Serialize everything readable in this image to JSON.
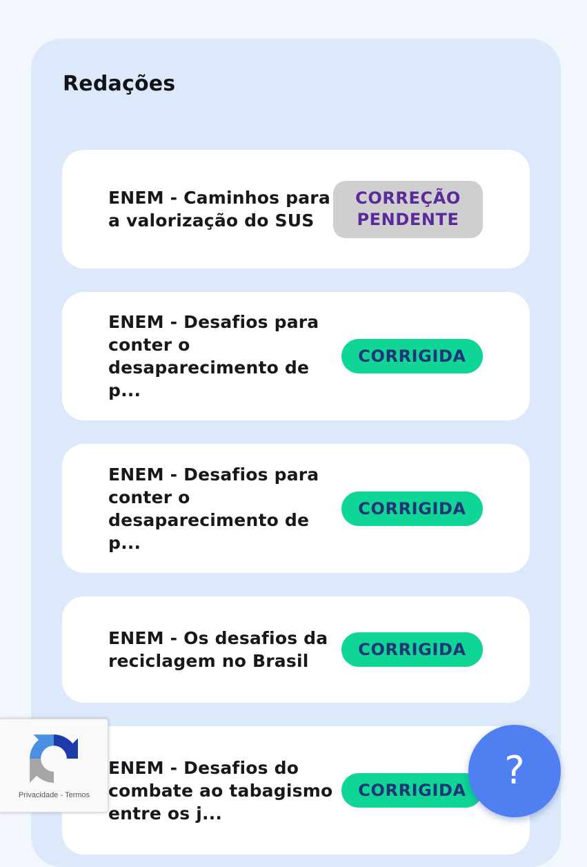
{
  "section": {
    "title": "Redações"
  },
  "essays": [
    {
      "title": "ENEM - Caminhos para a valorização do SUS",
      "status": "CORREÇÃO PENDENTE"
    },
    {
      "title": "ENEM - Desafios para conter o desaparecimento de p...",
      "status": "CORRIGIDA"
    },
    {
      "title": "ENEM - Desafios para conter o desaparecimento de p...",
      "status": "CORRIGIDA"
    },
    {
      "title": "ENEM - Os desafios da reciclagem no Brasil",
      "status": "CORRIGIDA"
    },
    {
      "title": "ENEM - Desafios do combate ao tabagismo entre os j...",
      "status": "CORRIGIDA"
    }
  ],
  "recaptcha": {
    "privacy_label": "Privacidade",
    "separator": "-",
    "terms_label": "Termos",
    "icon": "recaptcha-logo-icon"
  },
  "help": {
    "label": "?",
    "icon": "help-icon"
  },
  "colors": {
    "page_background": "#f2f6fd",
    "panel_background": "#dce9fb",
    "card_background": "#ffffff",
    "pending_badge": "#cfcfcf",
    "pending_text": "#5b2a9a",
    "done_badge": "#0fd596",
    "done_text": "#1f3576",
    "help_button": "#4f7ff0"
  }
}
